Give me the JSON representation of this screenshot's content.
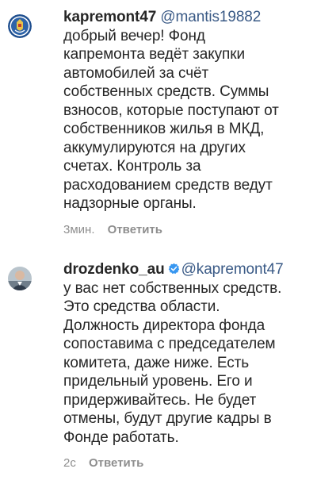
{
  "comments": [
    {
      "username": "kapremont47",
      "verified": false,
      "mention": "@mantis19882",
      "text": "добрый вечер! Фонд\nкапремонта ведёт закупки\nавтомобилей за счёт\nсобственных средств. Суммы\nвзносов, которые поступают от\nсобственников жилья в МКД,\nаккумулируются на других\nсчетах. Контроль за\nрасходованием средств ведут\nнадзорные органы.",
      "time": "3мин.",
      "reply_label": "Ответить",
      "avatar_icon": "regional-emblem-icon"
    },
    {
      "username": "drozdenko_au",
      "verified": true,
      "mention": "@kapremont47",
      "text": "у вас нет собственных средств.\nЭто средства области.\nДолжность директора фонда\nсопоставима с председателем\nкомитета, даже ниже. Есть\nпридельный уровень. Его и\nпридерживайтесь. Не будет\nотмены, будут другие кадры    в\nФонде работать.",
      "time": "2с",
      "reply_label": "Ответить",
      "avatar_icon": "user-photo-icon"
    }
  ],
  "colors": {
    "text": "#262626",
    "mention": "#3a5a86",
    "meta": "#8e8e8e",
    "verified": "#3897f0"
  }
}
